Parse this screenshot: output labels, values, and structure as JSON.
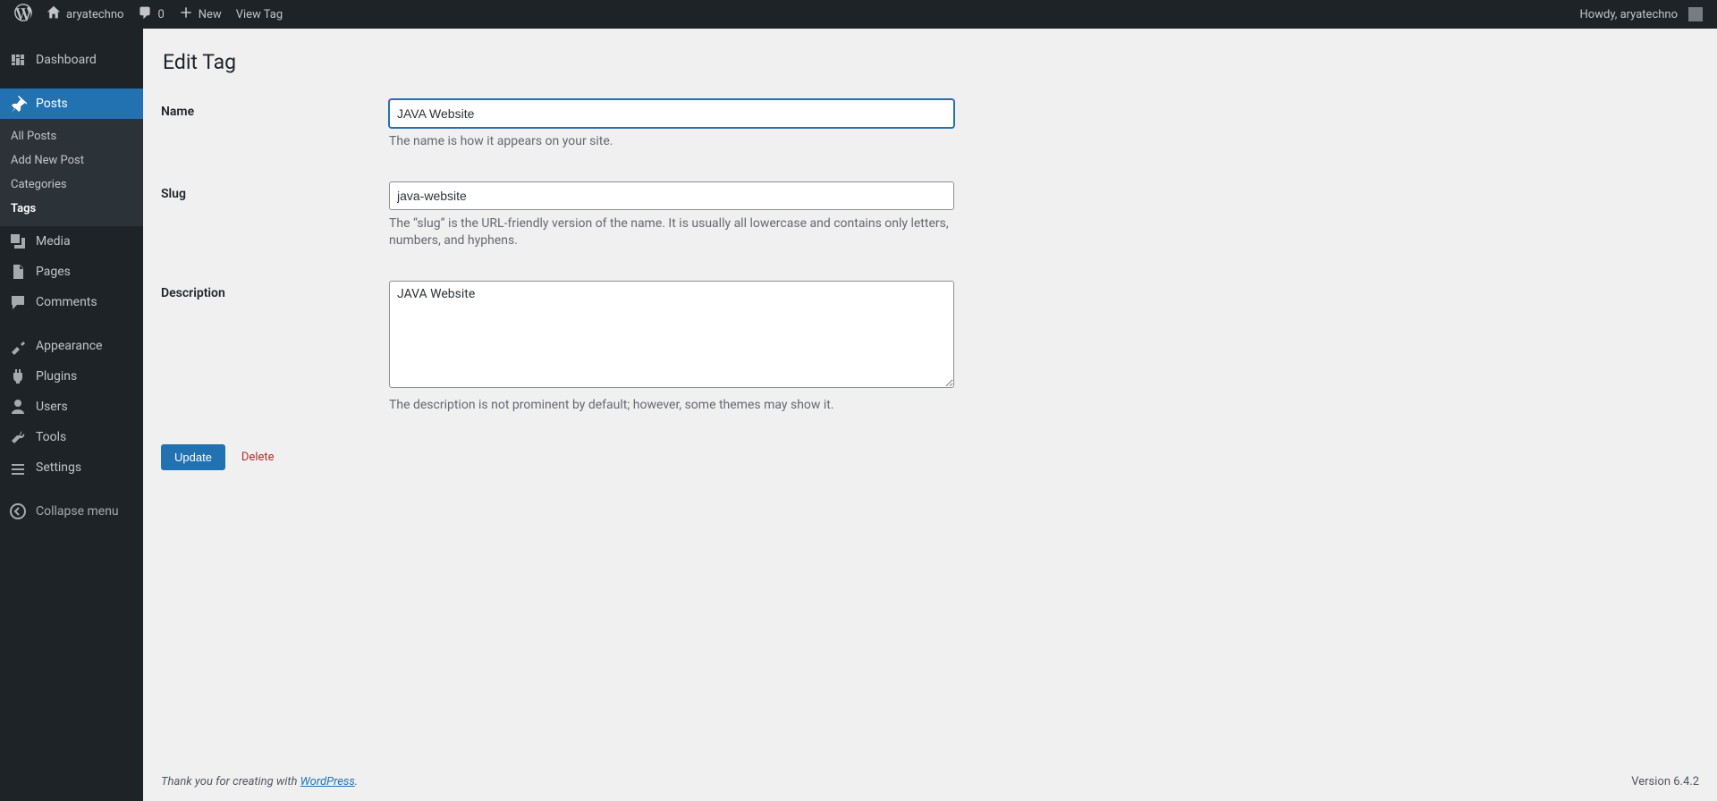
{
  "adminbar": {
    "site_name": "aryatechno",
    "comments_count": "0",
    "new_label": "New",
    "view_tag_label": "View Tag",
    "howdy": "Howdy, aryatechno"
  },
  "sidebar": {
    "dashboard": "Dashboard",
    "posts": "Posts",
    "posts_sub": {
      "all_posts": "All Posts",
      "add_new": "Add New Post",
      "categories": "Categories",
      "tags": "Tags"
    },
    "media": "Media",
    "pages": "Pages",
    "comments": "Comments",
    "appearance": "Appearance",
    "plugins": "Plugins",
    "users": "Users",
    "tools": "Tools",
    "settings": "Settings",
    "collapse": "Collapse menu"
  },
  "page": {
    "title": "Edit Tag",
    "fields": {
      "name_label": "Name",
      "name_value": "JAVA Website",
      "name_desc": "The name is how it appears on your site.",
      "slug_label": "Slug",
      "slug_value": "java-website",
      "slug_desc": "The “slug” is the URL-friendly version of the name. It is usually all lowercase and contains only letters, numbers, and hyphens.",
      "desc_label": "Description",
      "desc_value": "JAVA Website",
      "desc_desc": "The description is not prominent by default; however, some themes may show it."
    },
    "update_button": "Update",
    "delete_link": "Delete"
  },
  "footer": {
    "thanks_prefix": "Thank you for creating with ",
    "wordpress": "WordPress",
    "thanks_suffix": ".",
    "version": "Version 6.4.2"
  }
}
